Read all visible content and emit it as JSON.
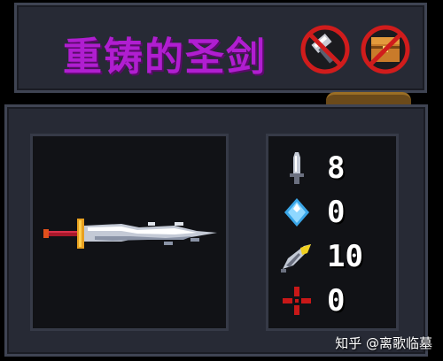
{
  "item": {
    "name": "重铸的圣剑"
  },
  "badges": [
    {
      "icon": "no-hammer-icon"
    },
    {
      "icon": "no-chest-icon"
    }
  ],
  "stats": [
    {
      "icon": "sword-damage-icon",
      "value": "8"
    },
    {
      "icon": "energy-crystal-icon",
      "value": "0"
    },
    {
      "icon": "critical-quill-icon",
      "value": "10"
    },
    {
      "icon": "accuracy-cross-icon",
      "value": "0"
    }
  ],
  "watermark": "知乎 @离歌临墓",
  "colors": {
    "title": "#b01ed0",
    "panel": "#272a35",
    "inner": "#111216",
    "ban_red": "#d01c1c"
  }
}
